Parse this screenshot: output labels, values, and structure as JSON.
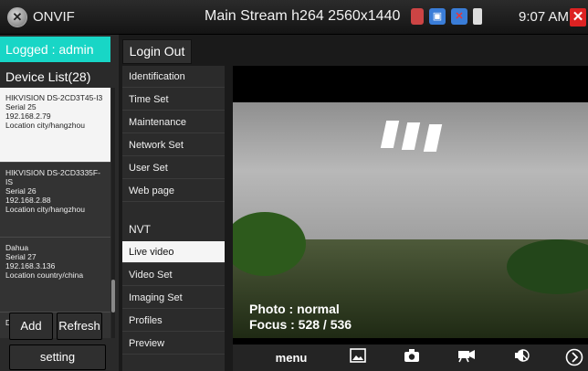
{
  "titlebar": {
    "app_name": "ONVIF",
    "stream_title": "Main Stream h264 2560x1440",
    "time": "9:07 AM"
  },
  "left": {
    "logged_label": "Logged : admin",
    "device_list_title": "Device List(28)",
    "devices": [
      {
        "name": "HIKVISION DS-2CD3T45-I3",
        "serial": "Serial 25",
        "ip": "192.168.2.79",
        "location": "Location city/hangzhou"
      },
      {
        "name": "HIKVISION DS-2CD3335F-IS",
        "serial": "Serial 26",
        "ip": "192.168.2.88",
        "location": "Location city/hangzhou"
      },
      {
        "name": "Dahua",
        "serial": "Serial 27",
        "ip": "192.168.3.136",
        "location": "Location country/china"
      },
      {
        "name": "Dahua",
        "serial": "",
        "ip": "",
        "location": ""
      }
    ],
    "add_label": "Add",
    "refresh_label": "Refresh",
    "setting_label": "setting"
  },
  "menu": {
    "login_out_label": "Login Out",
    "items": [
      "Identification",
      "Time Set",
      "Maintenance",
      "Network Set",
      "User Set",
      "Web page"
    ],
    "nvt_section": "NVT",
    "nvt_items": [
      "Live video",
      "Video Set",
      "Imaging Set",
      "Profiles",
      "Preview"
    ],
    "active_item": "Live video"
  },
  "video": {
    "photo_label": "Photo : normal",
    "focus_label": "Focus : 528 / 536"
  },
  "toolbar": {
    "menu_label": "menu"
  },
  "colors": {
    "accent": "#18d6c6",
    "close": "#dd2222"
  }
}
